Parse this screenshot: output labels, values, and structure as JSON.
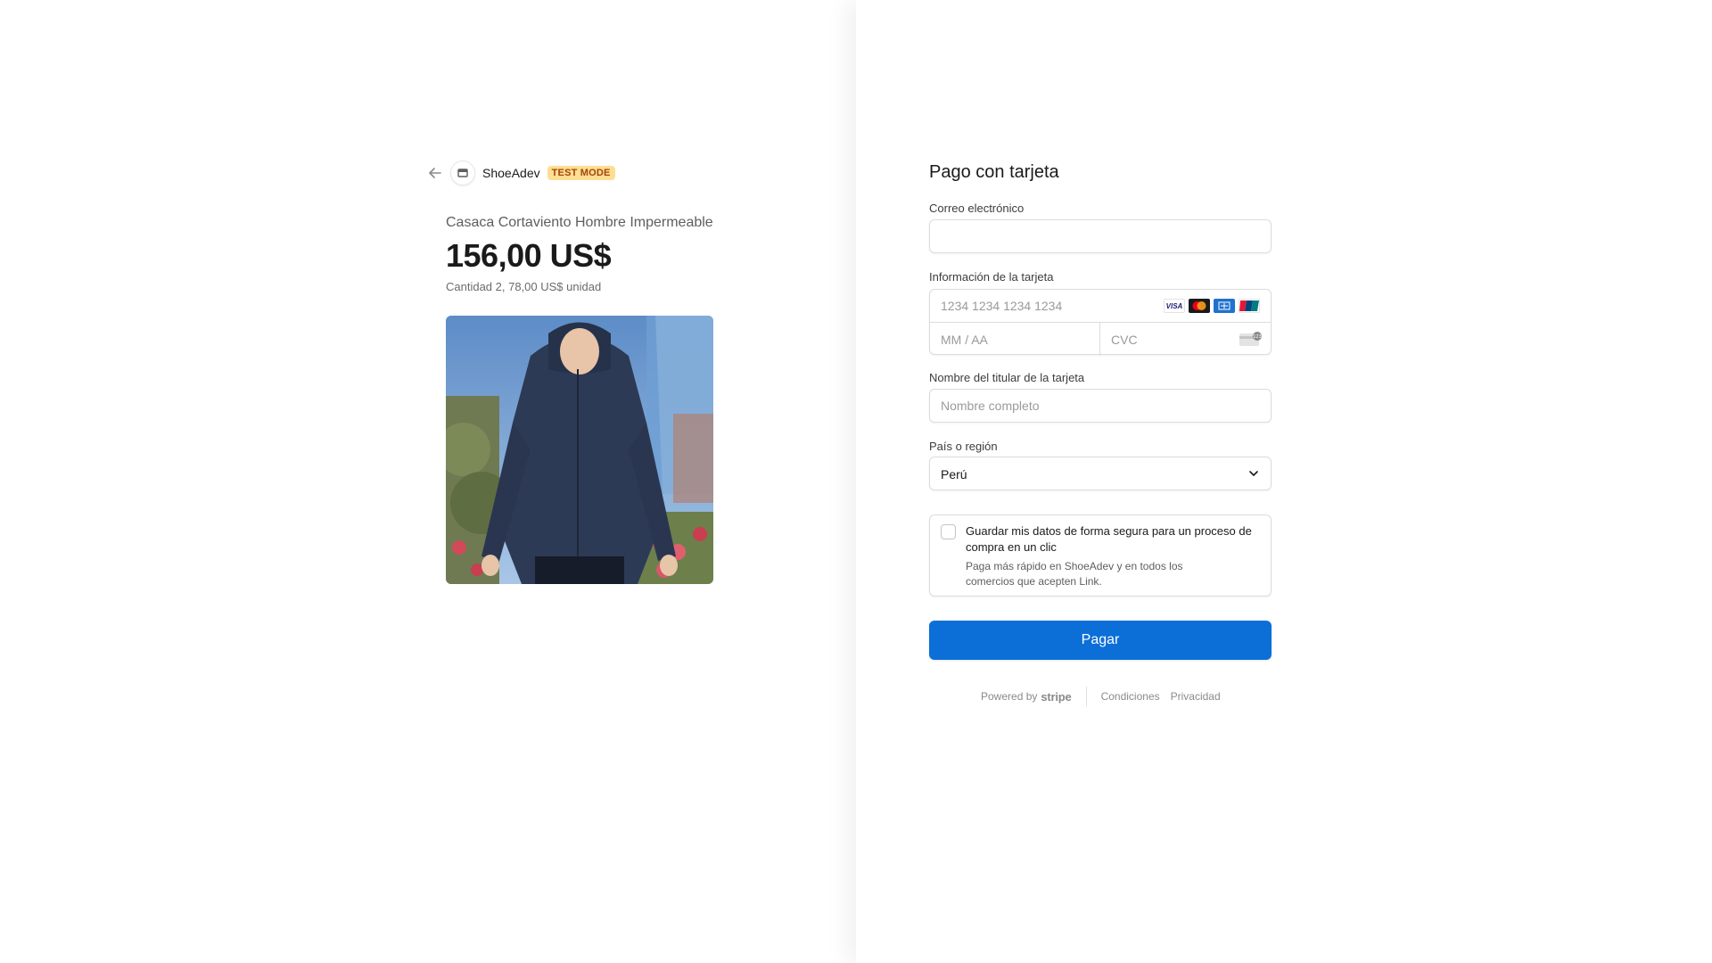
{
  "merchant": {
    "name": "ShoeAdev",
    "badge": "TEST MODE"
  },
  "product": {
    "name": "Casaca Cortaviento Hombre Impermeable",
    "price": "156,00 US$",
    "quantity_text": "Cantidad 2, 78,00 US$ unidad"
  },
  "form": {
    "title": "Pago con tarjeta",
    "email_label": "Correo electrónico",
    "email_value": "",
    "card_label": "Información de la tarjeta",
    "card_number_placeholder": "1234 1234 1234 1234",
    "expiry_placeholder": "MM / AA",
    "cvc_placeholder": "CVC",
    "cardholder_label": "Nombre del titular de la tarjeta",
    "cardholder_placeholder": "Nombre completo",
    "country_label": "País o región",
    "country_value": "Perú",
    "save_title": "Guardar mis datos de forma segura para un proceso de compra en un clic",
    "save_desc": "Paga más rápido en ShoeAdev y en todos los comercios que acepten Link.",
    "save_checked": false,
    "pay_label": "Pagar",
    "card_brands": [
      "visa-icon",
      "mastercard-icon",
      "amex-icon",
      "unionpay-icon"
    ]
  },
  "footer": {
    "powered_by": "Powered by",
    "stripe": "stripe",
    "terms": "Condiciones",
    "privacy": "Privacidad"
  },
  "colors": {
    "pay_button": "#0c6fd8",
    "badge_bg": "#ffde92",
    "badge_text": "#a0460c"
  }
}
